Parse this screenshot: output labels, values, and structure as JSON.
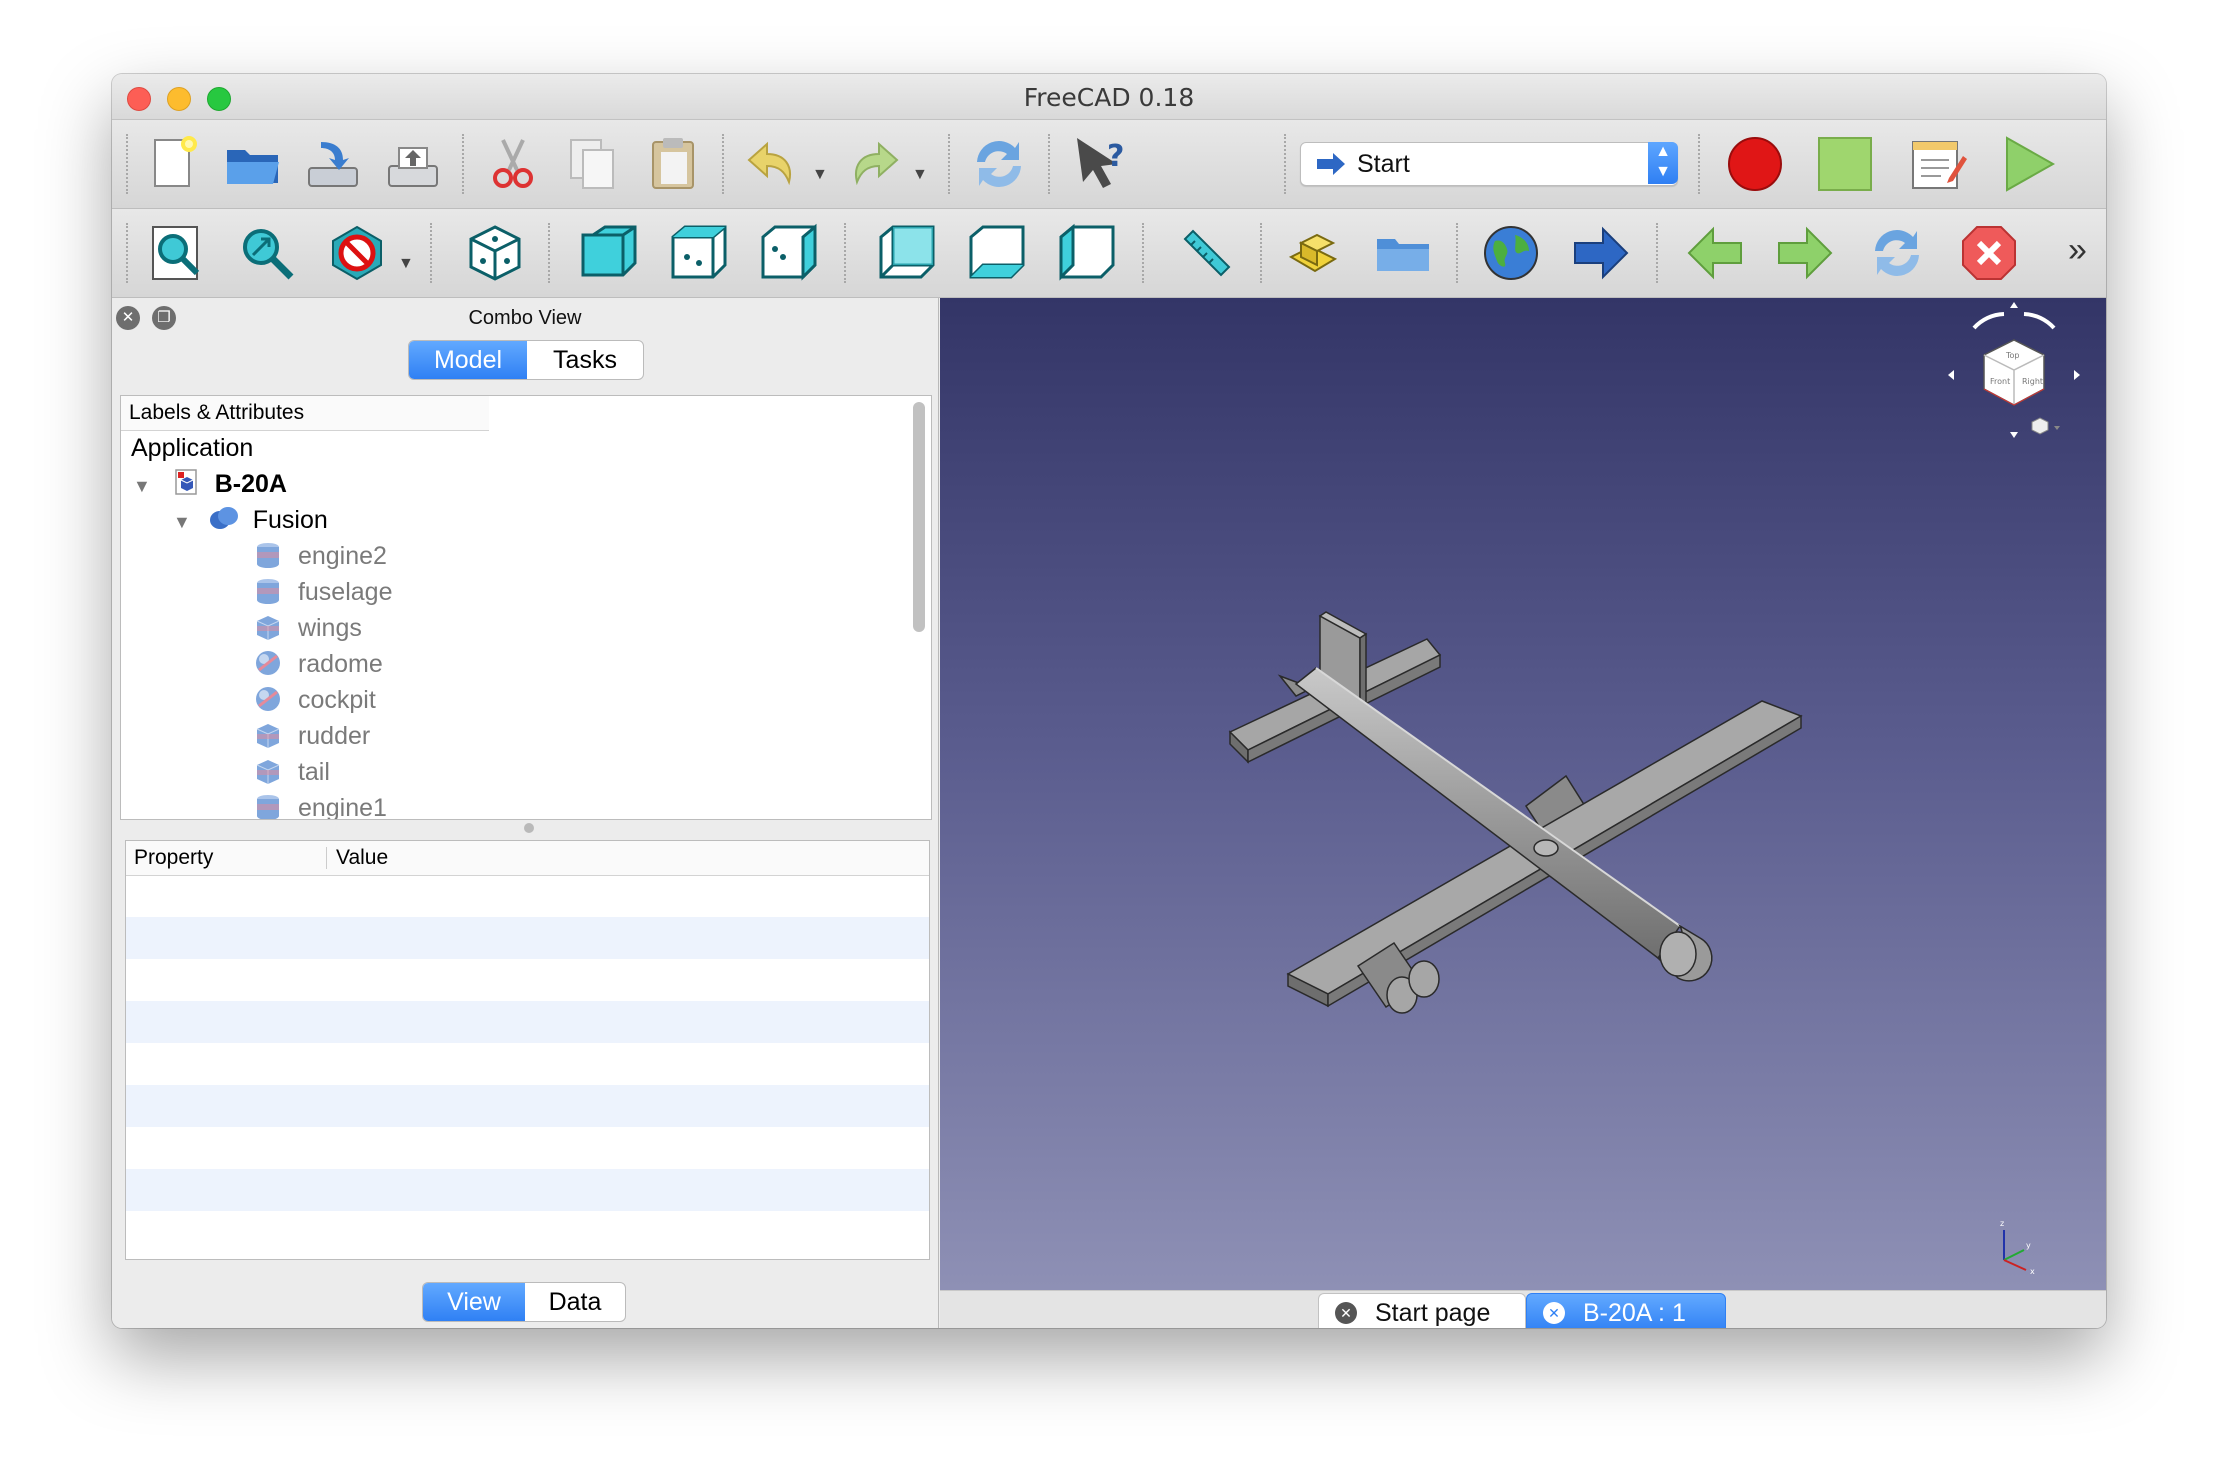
{
  "window": {
    "title": "FreeCAD 0.18"
  },
  "toolbar1": {
    "workbench": "Start",
    "icons": [
      "new-document-icon",
      "open-folder-icon",
      "save-icon",
      "print-icon",
      "cut-icon",
      "copy-icon",
      "paste-icon",
      "undo-icon",
      "redo-icon",
      "refresh-icon",
      "whats-this-icon",
      "record-macro-icon",
      "stop-macro-icon",
      "edit-macro-icon",
      "run-macro-icon"
    ]
  },
  "toolbar2": {
    "icons": [
      "fit-all-icon",
      "fit-selection-icon",
      "draw-style-icon",
      "isometric-view-icon",
      "front-view-icon",
      "top-view-icon",
      "right-view-icon",
      "rear-view-icon",
      "bottom-view-icon",
      "left-view-icon",
      "measure-distance-icon",
      "part-icon",
      "group-folder-icon",
      "web-globe-icon",
      "arrow-right-icon",
      "nav-back-icon",
      "nav-forward-icon",
      "nav-refresh-icon",
      "nav-stop-icon"
    ],
    "overflow": "»"
  },
  "combo": {
    "title": "Combo View",
    "tabs": [
      {
        "label": "Model",
        "active": true
      },
      {
        "label": "Tasks",
        "active": false
      }
    ],
    "tree_header": "Labels & Attributes",
    "tree": {
      "root": "Application",
      "document": "B-20A",
      "group": "Fusion",
      "children": [
        "engine2",
        "fuselage",
        "wings",
        "radome",
        "cockpit",
        "rudder",
        "tail",
        "engine1"
      ]
    },
    "property_header": {
      "property": "Property",
      "value": "Value"
    },
    "bottom_tabs": [
      {
        "label": "View",
        "active": true
      },
      {
        "label": "Data",
        "active": false
      }
    ]
  },
  "doc_tabs": [
    {
      "label": "Start page",
      "active": false
    },
    {
      "label": "B-20A : 1",
      "active": true
    }
  ],
  "colors": {
    "accent": "#3385f6",
    "viewport_top": "#333567",
    "viewport_bottom": "#8e90b5",
    "model_grey": "#9a9a9a"
  }
}
